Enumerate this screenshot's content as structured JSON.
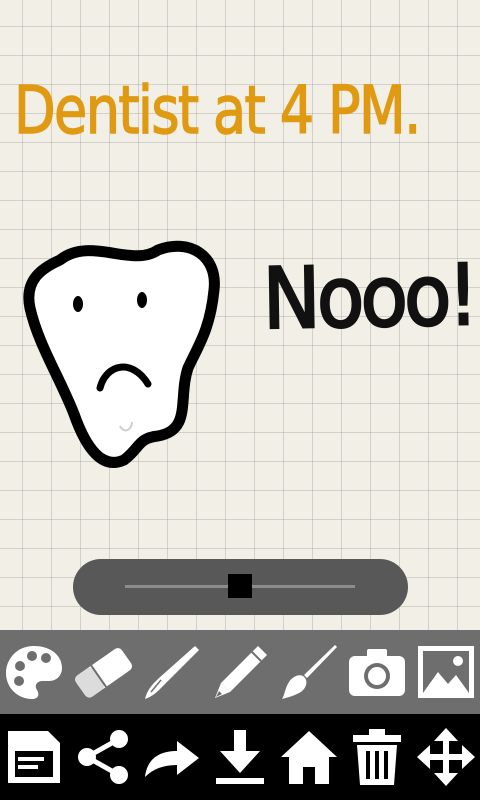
{
  "note": {
    "line1": "Dentist at 4 PM.",
    "line2": "Nooo!",
    "line1_color": "#e09a12",
    "line2_color": "#111111"
  },
  "drawing": {
    "tooth": "frowning-tooth-doodle"
  },
  "brush_size_slider": {
    "value_fraction": 0.5
  },
  "colors": {
    "canvas_background": "#f2efe6",
    "tool_bar": "#6e6e6e",
    "action_bar": "#000000",
    "icon": "#ffffff"
  },
  "tool_bar": [
    "palette-icon",
    "eraser-icon",
    "brush-icon",
    "pencil-icon",
    "paintbrush-icon",
    "camera-icon",
    "image-icon"
  ],
  "action_bar": [
    "save-icon",
    "share-icon",
    "redo-icon",
    "download-icon",
    "home-icon",
    "trash-icon",
    "move-icon"
  ]
}
